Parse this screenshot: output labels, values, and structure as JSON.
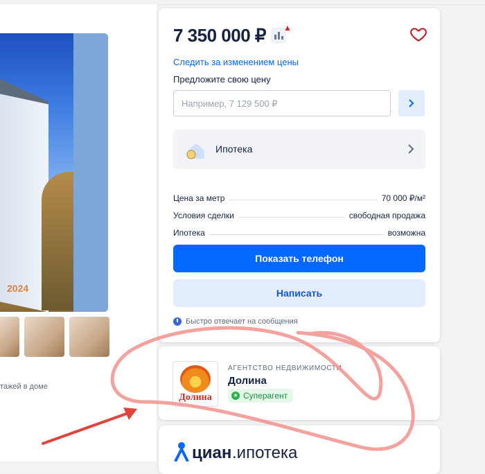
{
  "gallery": {
    "photo_stamp": "2024",
    "floors_text": "тажей в доме"
  },
  "price_card": {
    "price": "7 350 000 ₽",
    "follow_link": "Следить за изменением цены",
    "offer_label": "Предложите свою цену",
    "offer_placeholder": "Например, 7 129 500 ₽",
    "mortgage_label": "Ипотека",
    "params": [
      {
        "name": "Цена за метр",
        "value": "70 000 ₽/м²"
      },
      {
        "name": "Условия сделки",
        "value": "свободная продажа"
      },
      {
        "name": "Ипотека",
        "value": "возможна"
      }
    ],
    "phone_button": "Показать телефон",
    "write_button": "Написать",
    "quick_reply": "Быстро отвечает на сообщения"
  },
  "agent_card": {
    "type": "АГЕНТСТВО НЕДВИЖИМОСТИ",
    "name": "Долина",
    "logo_text": "Долина",
    "badge": "Суперагент"
  },
  "cian_card": {
    "brand": "циан",
    "sub": ".ипотека"
  },
  "colors": {
    "accent": "#0468ff",
    "annotation_red": "#e0443a",
    "scribble_pink": "#f2928c"
  }
}
